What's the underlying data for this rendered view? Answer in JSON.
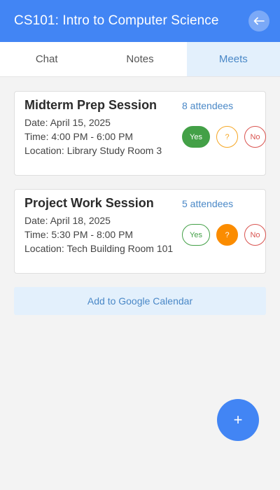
{
  "header": {
    "title": "CS101: Intro to Computer Science",
    "back_icon": "arrow-left-icon"
  },
  "tabs": [
    {
      "label": "Chat",
      "active": false
    },
    {
      "label": "Notes",
      "active": false
    },
    {
      "label": "Meets",
      "active": true
    }
  ],
  "meetings": [
    {
      "title": "Midterm Prep Session",
      "attendees": "8 attendees",
      "date": "Date: April 15, 2025",
      "time": "Time: 4:00 PM - 6:00 PM",
      "location": "Location: Library Study Room 3",
      "rsvp": {
        "yes": "Yes",
        "maybe": "?",
        "no": "No",
        "selected": "yes"
      }
    },
    {
      "title": "Project Work Session",
      "attendees": "5 attendees",
      "date": "Date: April 18, 2025",
      "time": "Time: 5:30 PM - 8:00 PM",
      "location": "Location: Tech Building Room 101",
      "rsvp": {
        "yes": "Yes",
        "maybe": "?",
        "no": "No",
        "selected": "maybe"
      }
    }
  ],
  "calendar_button": "Add to Google Calendar",
  "fab": {
    "label": "+",
    "icon": "plus-icon"
  },
  "colors": {
    "primary": "#4285f4",
    "tab_active_bg": "#e3f0fc",
    "link": "#4a88c7",
    "yes": "#43a047",
    "maybe": "#fb8c00",
    "no": "#d9534f"
  }
}
